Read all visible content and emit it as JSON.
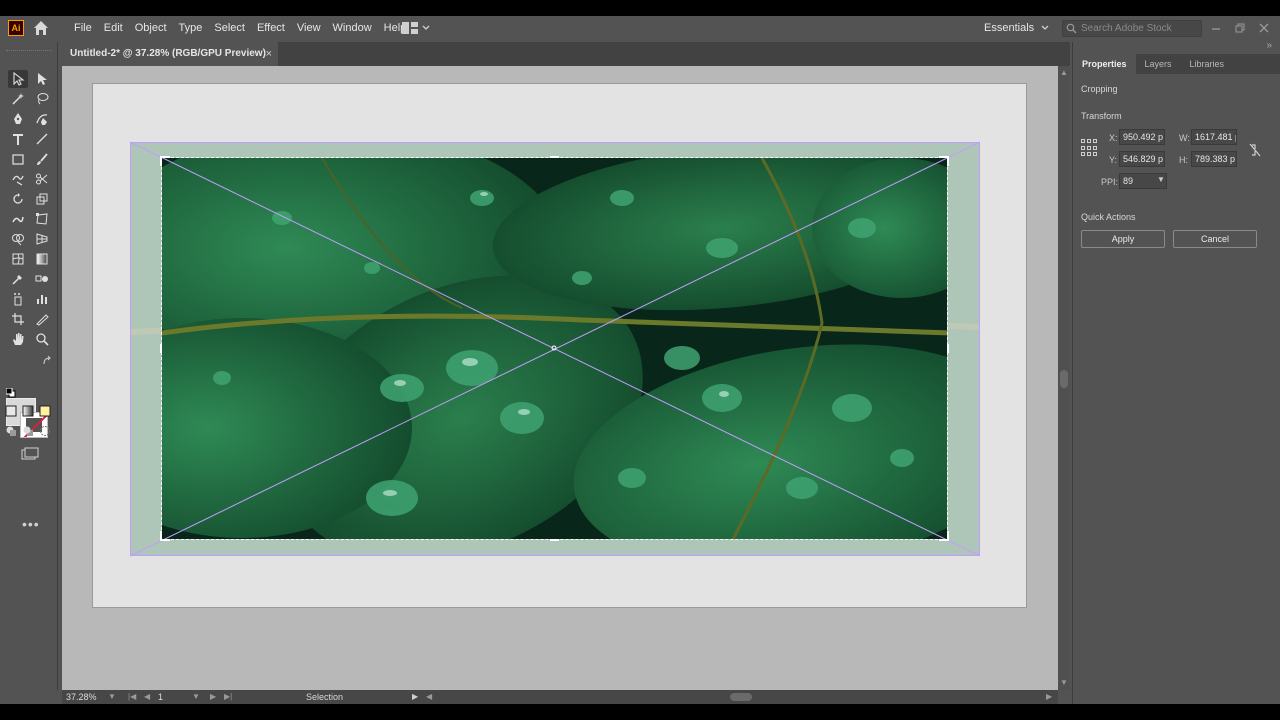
{
  "app": {
    "logo_text": "Ai"
  },
  "menu": [
    "File",
    "Edit",
    "Object",
    "Type",
    "Select",
    "Effect",
    "View",
    "Window",
    "Help"
  ],
  "workspace": {
    "label": "Essentials"
  },
  "search": {
    "placeholder": "Search Adobe Stock"
  },
  "document_tab": {
    "title": "Untitled-2* @ 37.28% (RGB/GPU Preview)",
    "close": "×"
  },
  "status": {
    "zoom": "37.28%",
    "page": "1",
    "tool": "Selection"
  },
  "panel": {
    "tabs": [
      "Properties",
      "Layers",
      "Libraries"
    ],
    "section_cropping": "Cropping",
    "section_transform": "Transform",
    "x_label": "X:",
    "x_value": "950.492 p",
    "w_label": "W:",
    "w_value": "1617.481 p",
    "y_label": "Y:",
    "y_value": "546.829 p",
    "h_label": "H:",
    "h_value": "789.383 p",
    "ppi_label": "PPI:",
    "ppi_value": "89",
    "section_quick": "Quick Actions",
    "apply": "Apply",
    "cancel": "Cancel"
  },
  "colors": {
    "ui_bg": "#535353",
    "canvas": "#b8b8b8",
    "artboard": "#e3e3e3",
    "accent_logo": "#ff9a00",
    "guide": "#c49cff",
    "leaf": "#1e6b3e"
  },
  "icons": [
    "home-icon",
    "workspace-switcher-icon",
    "search-icon",
    "minimize-icon",
    "restore-icon",
    "close-icon",
    "link-proportions-icon"
  ]
}
